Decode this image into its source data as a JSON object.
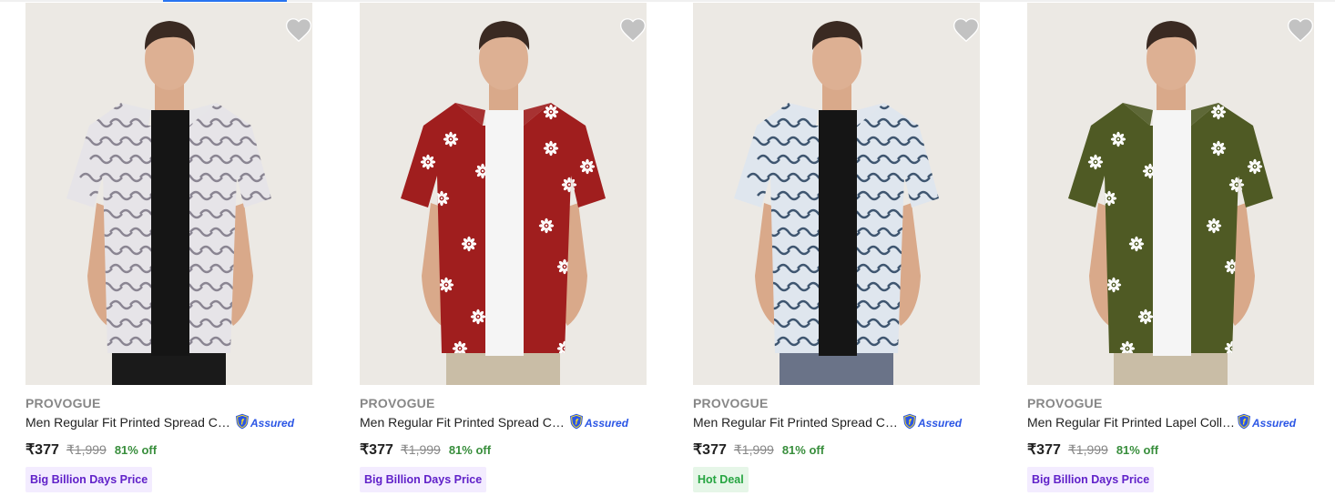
{
  "products": [
    {
      "brand": "PROVOGUE",
      "title": "Men Regular Fit Printed Spread Collar Casual Shirt",
      "assured": "Assured",
      "price": "₹377",
      "mrp": "₹1,999",
      "discount": "81% off",
      "deal": "Big Billion Days Price",
      "deal_type": "bbd",
      "shirt_color": "#e6e4e8",
      "print_color": "#8a8592",
      "undershirt_color": "#151515",
      "pants_color": "#1a1a1a",
      "print": "pattern"
    },
    {
      "brand": "PROVOGUE",
      "title": "Men Regular Fit Printed Spread Collar Casual Shirt",
      "assured": "Assured",
      "price": "₹377",
      "mrp": "₹1,999",
      "discount": "81% off",
      "deal": "Big Billion Days Price",
      "deal_type": "bbd",
      "shirt_color": "#a01e1e",
      "print_color": "#ffffff",
      "undershirt_color": "#f5f5f5",
      "pants_color": "#c9bda6",
      "print": "flowers"
    },
    {
      "brand": "PROVOGUE",
      "title": "Men Regular Fit Printed Spread Collar Casual Shirt",
      "assured": "Assured",
      "price": "₹377",
      "mrp": "₹1,999",
      "discount": "81% off",
      "deal": "Hot Deal",
      "deal_type": "hot",
      "shirt_color": "#dfe6ee",
      "print_color": "#3f5670",
      "undershirt_color": "#151515",
      "pants_color": "#6a7388",
      "print": "pattern"
    },
    {
      "brand": "PROVOGUE",
      "title": "Men Regular Fit Printed Lapel Collar Casual Shirt",
      "assured": "Assured",
      "price": "₹377",
      "mrp": "₹1,999",
      "discount": "81% off",
      "deal": "Big Billion Days Price",
      "deal_type": "bbd",
      "shirt_color": "#4f5a24",
      "print_color": "#ffffff",
      "undershirt_color": "#f5f5f5",
      "pants_color": "#c9bda6",
      "print": "flowers"
    }
  ],
  "icons": {
    "wishlist": "heart-icon",
    "assured": "flipkart-assured-shield-icon"
  },
  "colors": {
    "accent": "#2874f0",
    "discount_green": "#388e3c",
    "bbd_purple": "#6021c9",
    "hot_green": "#26a541",
    "assured_blue": "#2a55e5"
  }
}
